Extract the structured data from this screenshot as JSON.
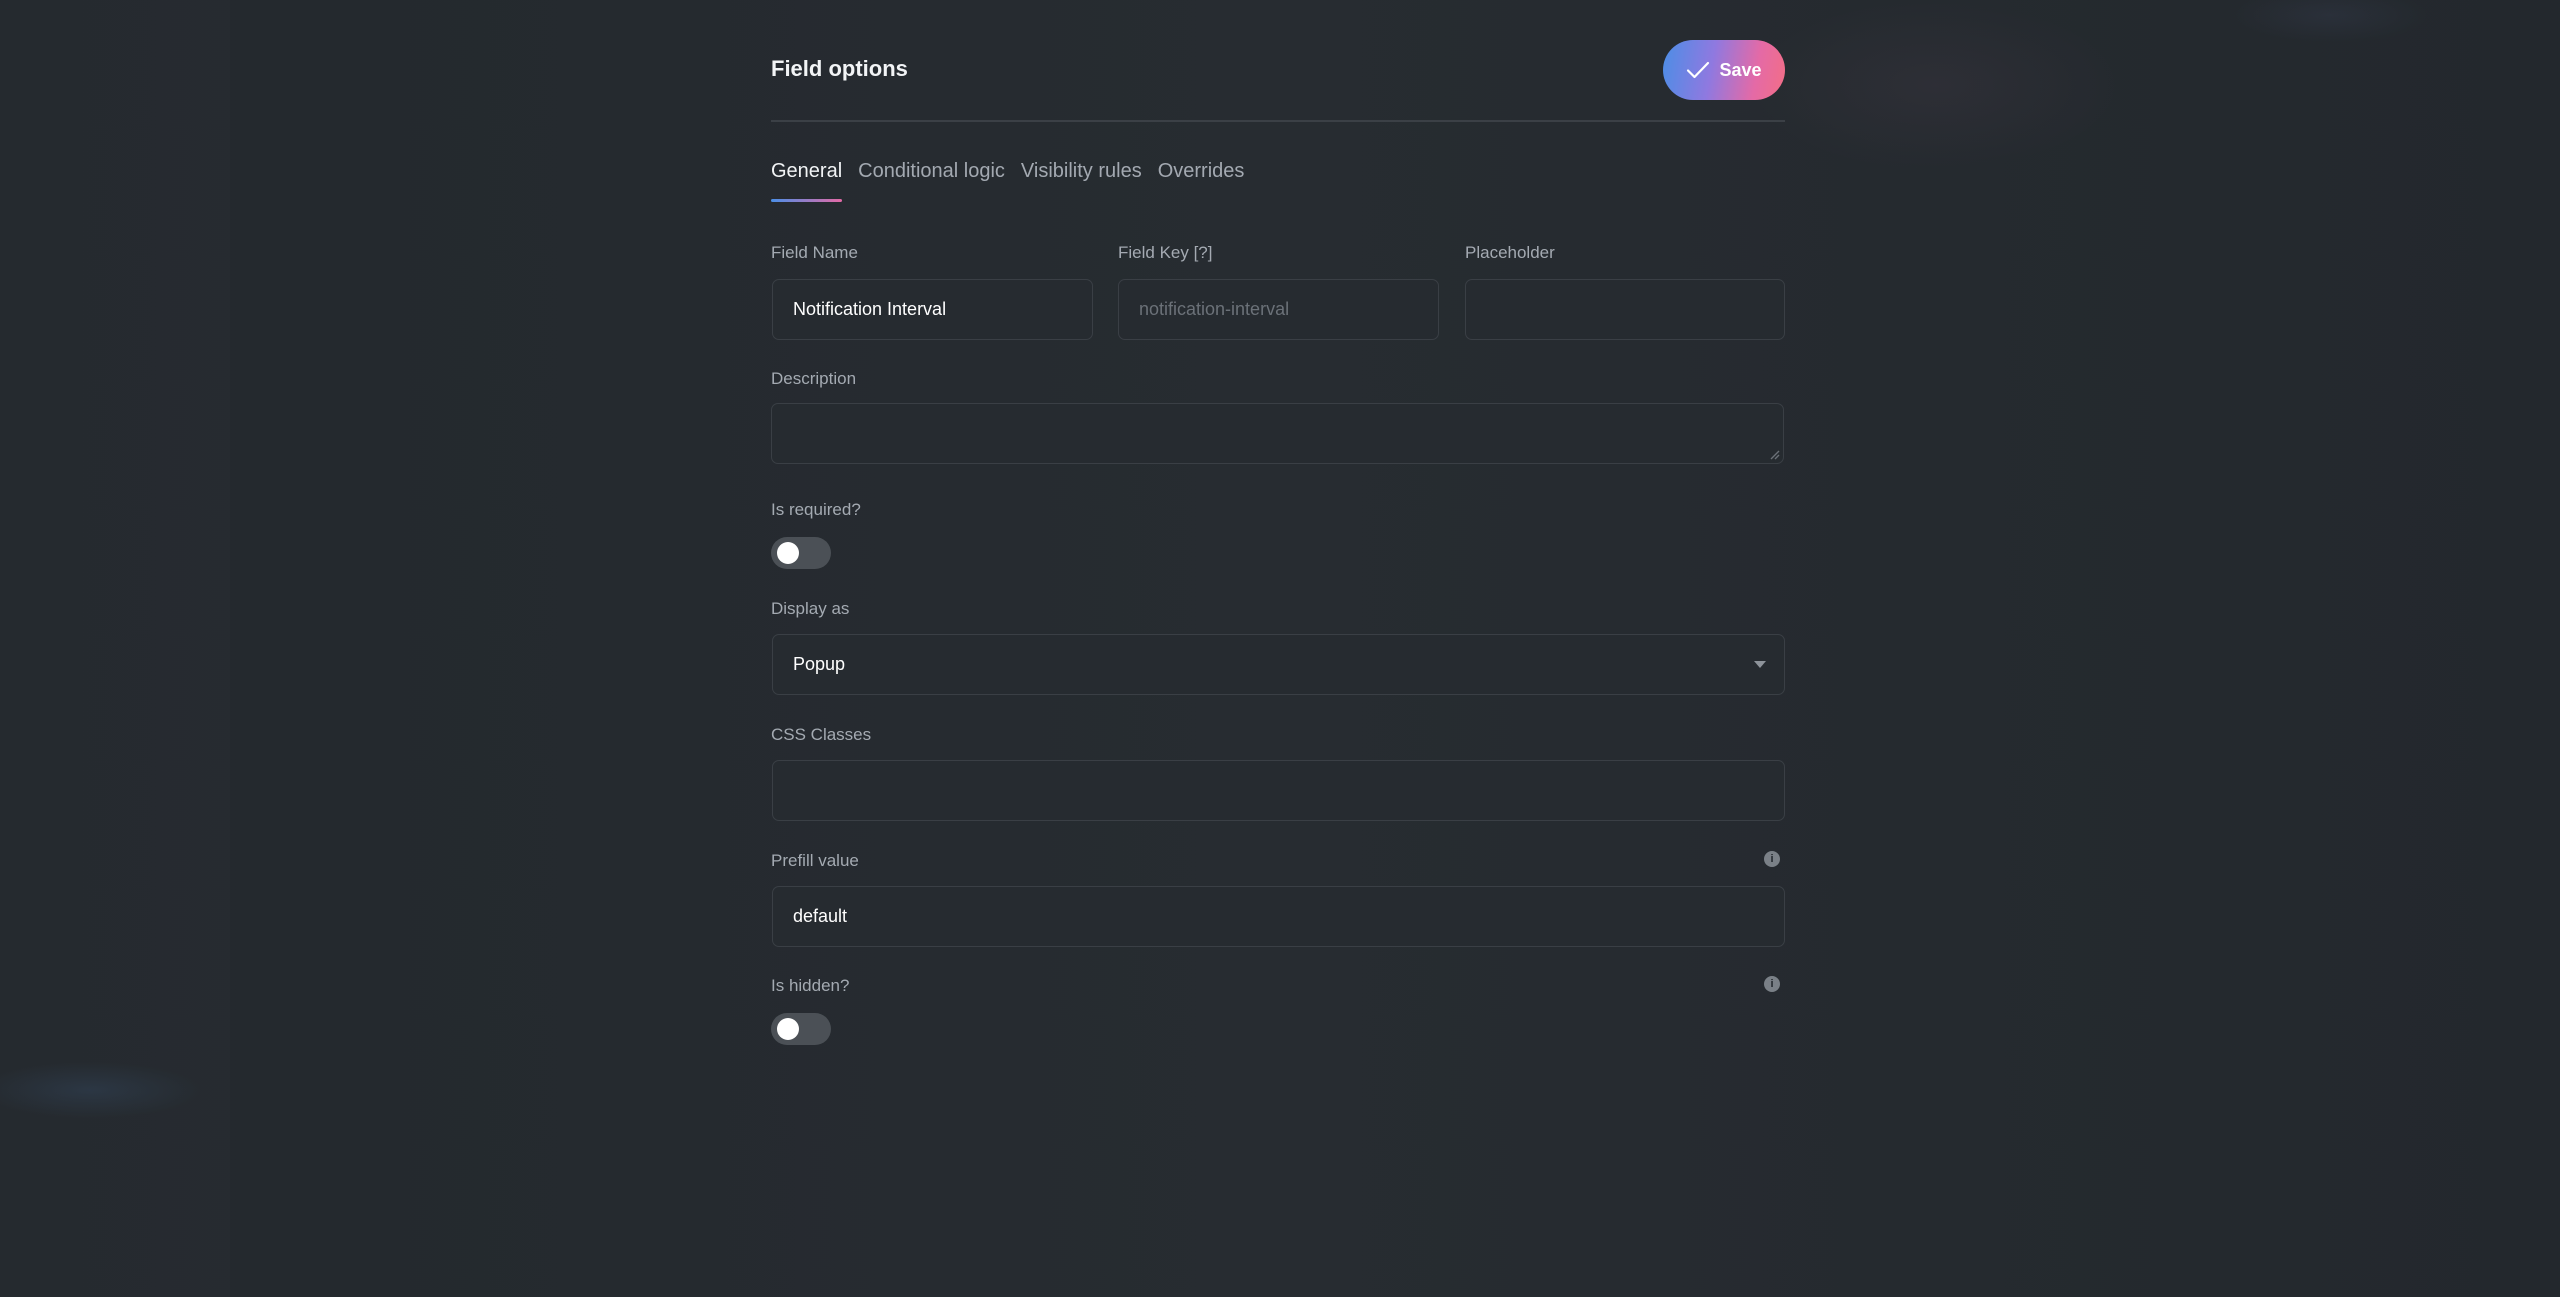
{
  "panel": {
    "title": "Field options",
    "save_label": "Save"
  },
  "tabs": [
    {
      "label": "General",
      "active": true
    },
    {
      "label": "Conditional logic",
      "active": false
    },
    {
      "label": "Visibility rules",
      "active": false
    },
    {
      "label": "Overrides",
      "active": false
    }
  ],
  "form": {
    "field_name": {
      "label": "Field Name",
      "value": "Notification Interval"
    },
    "field_key": {
      "label": "Field Key [?]",
      "placeholder": "notification-interval"
    },
    "placeholder": {
      "label": "Placeholder",
      "value": ""
    },
    "description": {
      "label": "Description",
      "value": ""
    },
    "is_required": {
      "label": "Is required?",
      "on": false
    },
    "display_as": {
      "label": "Display as",
      "selected": "Popup"
    },
    "css_classes": {
      "label": "CSS Classes",
      "value": ""
    },
    "prefill": {
      "label": "Prefill value",
      "value": "default"
    },
    "is_hidden": {
      "label": "Is hidden?",
      "on": false
    }
  },
  "colors": {
    "background": "#22272c",
    "accent_gradient_start": "#4b8ee6",
    "accent_gradient_end": "#f36e86",
    "text": "#f2f4f6",
    "muted_text": "#a4aab2"
  },
  "icons": {
    "save": "checkmark-icon",
    "info": "info-icon",
    "select": "caret-down-icon"
  }
}
